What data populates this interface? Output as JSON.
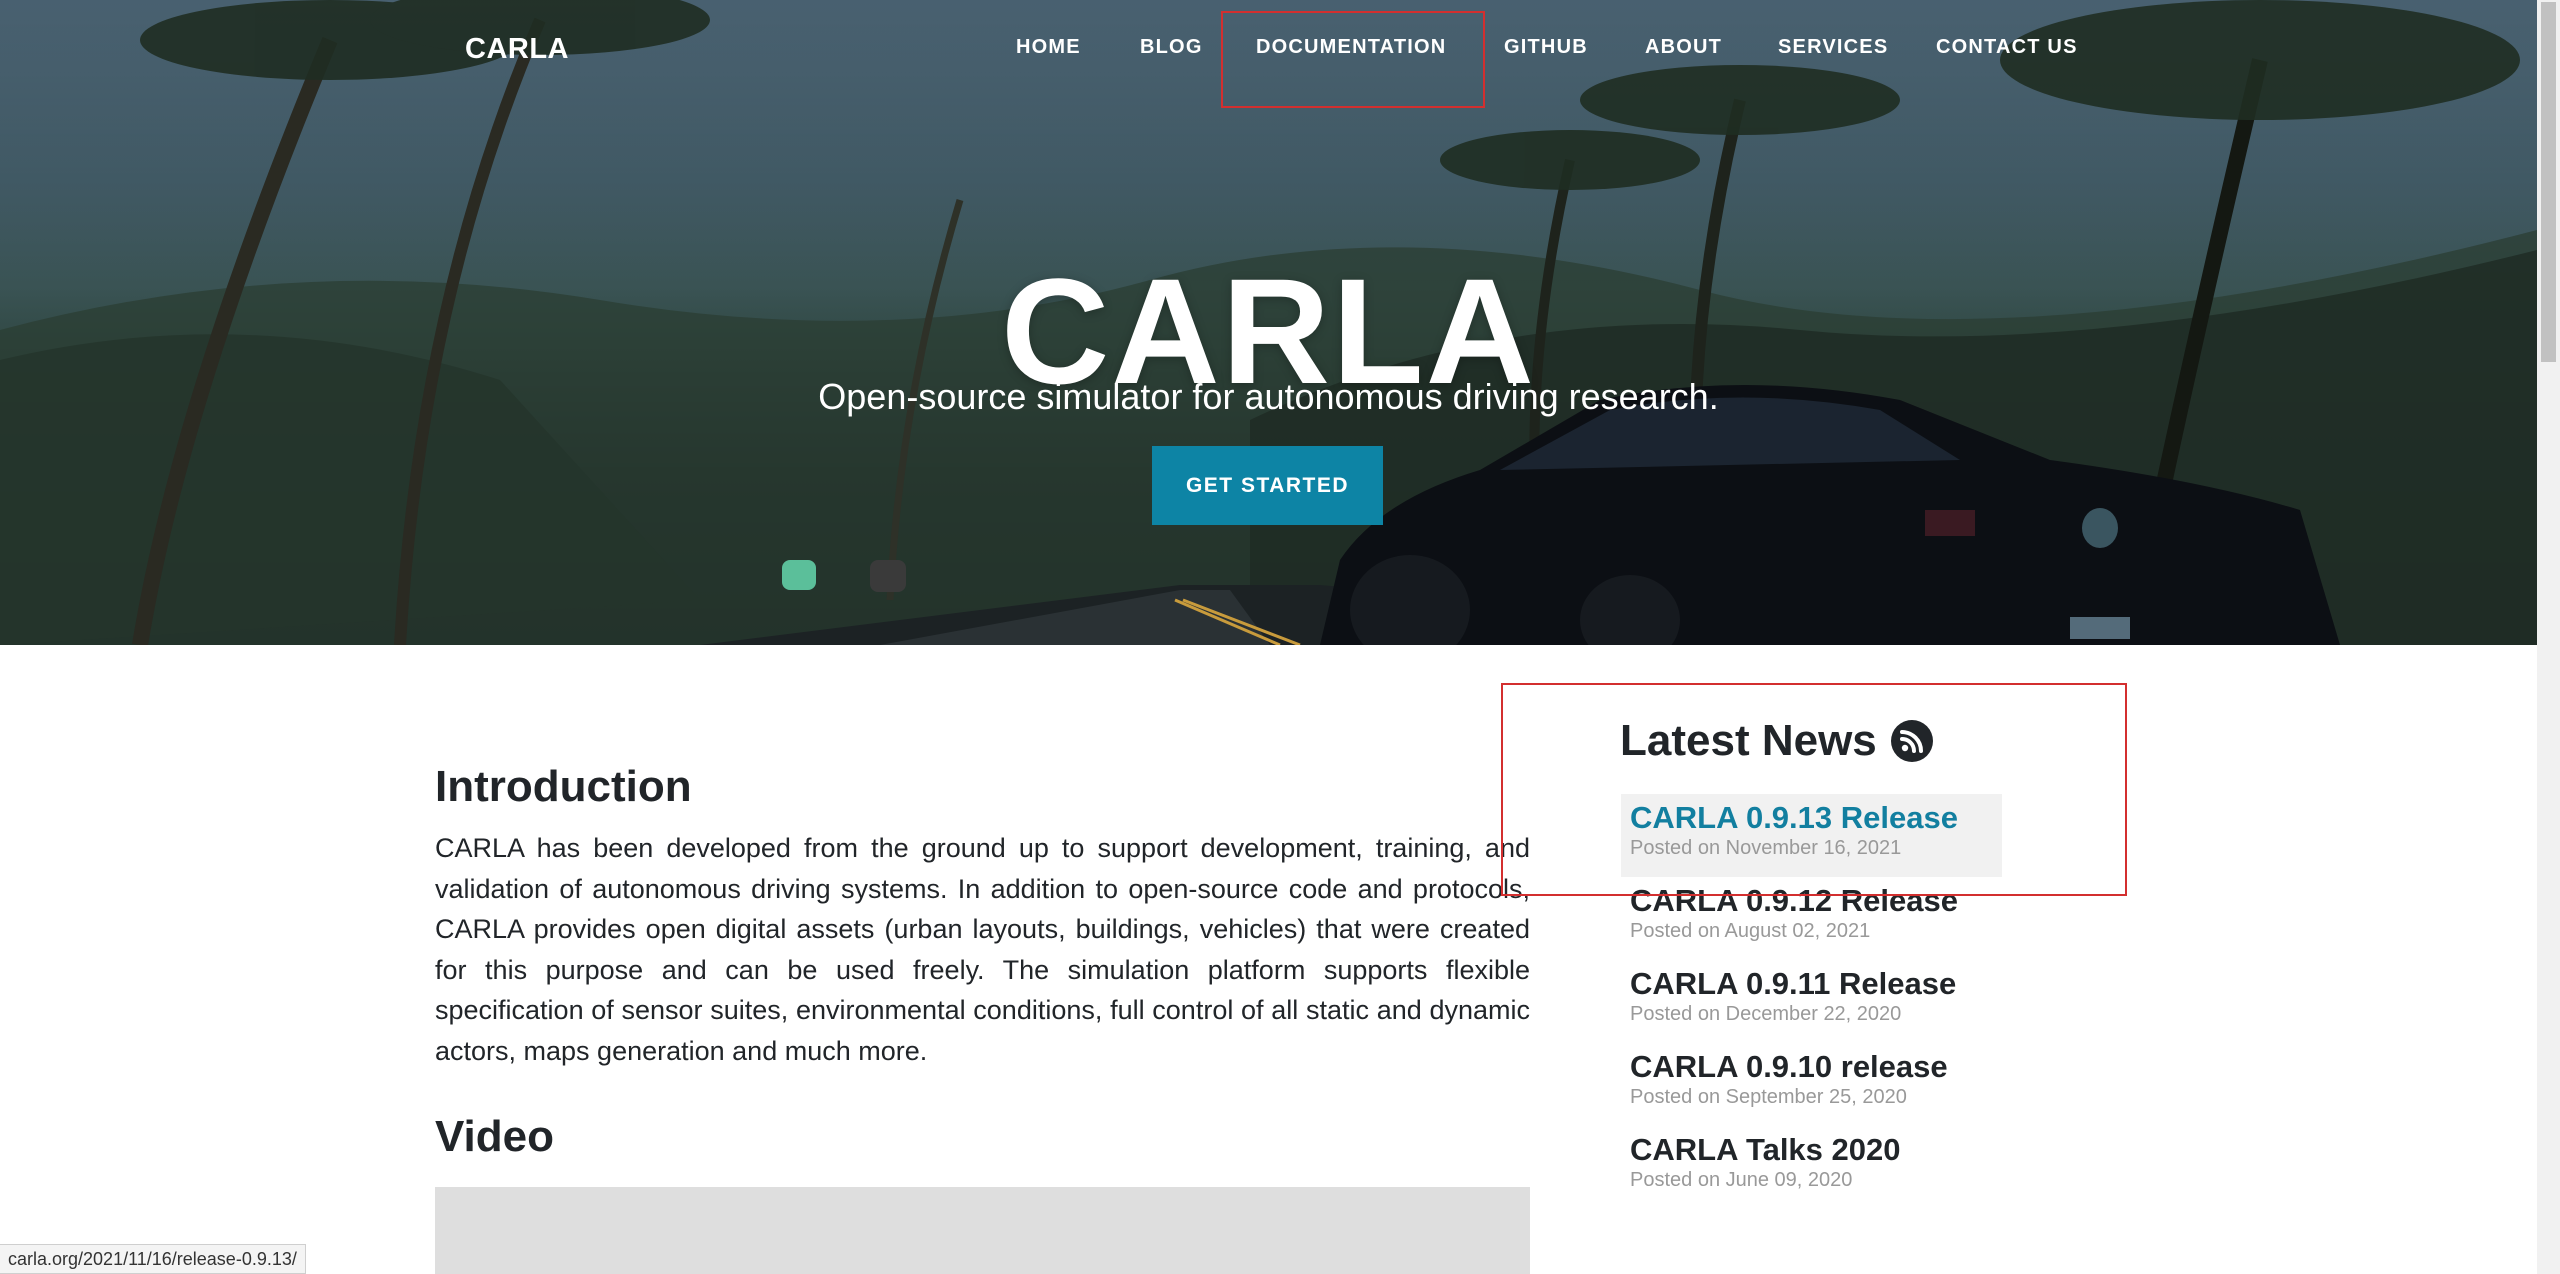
{
  "nav": {
    "brand": "CARLA",
    "items": [
      {
        "label": "HOME"
      },
      {
        "label": "BLOG"
      },
      {
        "label": "DOCUMENTATION"
      },
      {
        "label": "GITHUB"
      },
      {
        "label": "ABOUT"
      },
      {
        "label": "SERVICES"
      },
      {
        "label": "CONTACT US"
      }
    ]
  },
  "hero": {
    "title": "CARLA",
    "subtitle": "Open-source simulator for autonomous driving research.",
    "cta_label": "GET STARTED"
  },
  "intro": {
    "title": "Introduction",
    "text": "CARLA has been developed from the ground up to support development, training, and validation of autonomous driving systems. In addition to open-source code and protocols, CARLA provides open digital assets (urban layouts, buildings, vehicles) that were created for this purpose and can be used freely. The simulation platform supports flexible specification of sensor suites, environmental conditions, full control of all static and dynamic actors, maps generation and much more."
  },
  "video": {
    "title": "Video"
  },
  "news": {
    "title": "Latest News",
    "icon": "rss-icon",
    "items": [
      {
        "title": "CARLA 0.9.13 Release",
        "date": "Posted on November 16, 2021"
      },
      {
        "title": "CARLA 0.9.12 Release",
        "date": "Posted on August 02, 2021"
      },
      {
        "title": "CARLA 0.9.11 Release",
        "date": "Posted on December 22, 2020"
      },
      {
        "title": "CARLA 0.9.10 release",
        "date": "Posted on September 25, 2020"
      },
      {
        "title": "CARLA Talks 2020",
        "date": "Posted on June 09, 2020"
      }
    ]
  },
  "status_bar": {
    "url": "carla.org/2021/11/16/release-0.9.13/"
  },
  "colors": {
    "accent": "#0d84a5",
    "link_active": "#127fa0",
    "highlight_box": "#d32f2f"
  }
}
